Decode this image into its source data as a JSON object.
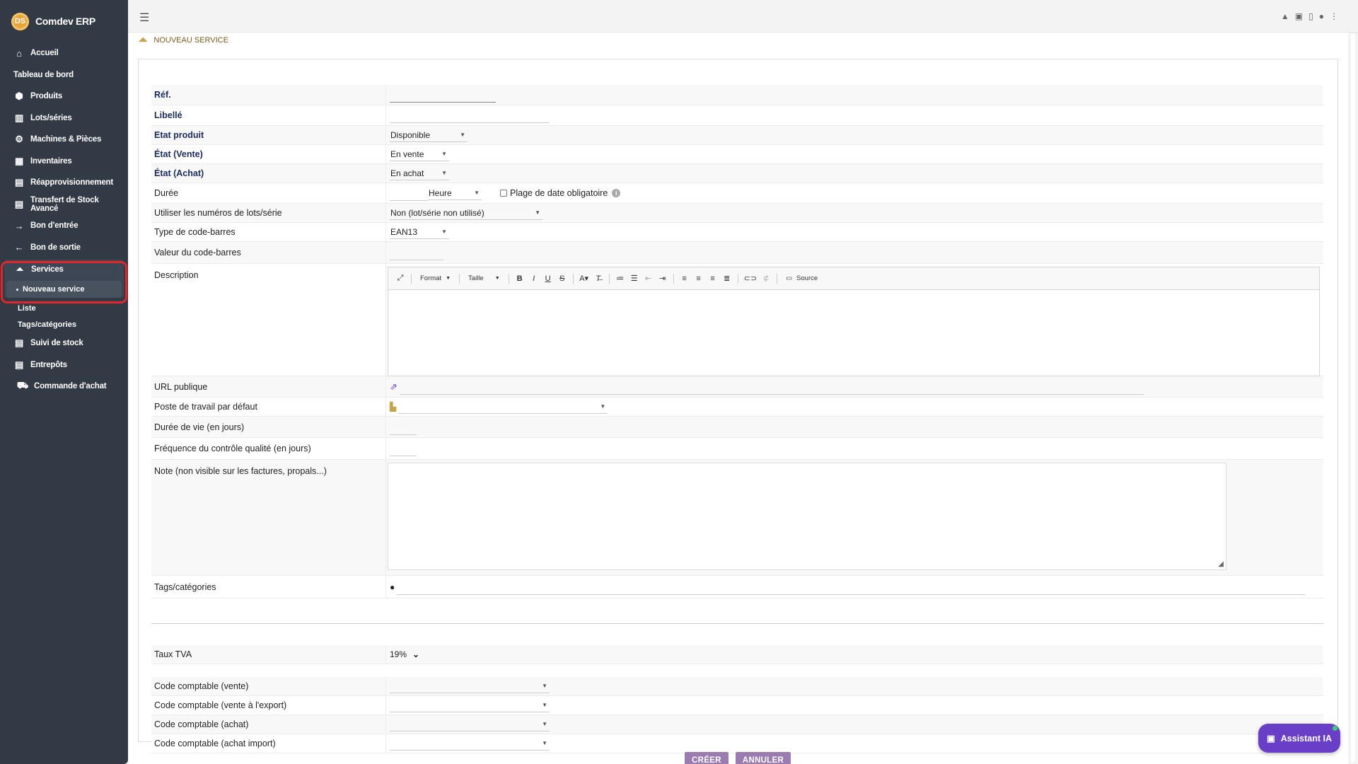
{
  "app": {
    "name": "Comdev ERP",
    "logo_text": "DS"
  },
  "sidebar": {
    "items": [
      {
        "label": "Accueil",
        "icon": "home-icon",
        "glyph": "⌂"
      },
      {
        "label": "Tableau de bord",
        "icon": "",
        "glyph": ""
      },
      {
        "label": "Produits",
        "icon": "cube-icon",
        "glyph": "⬢"
      },
      {
        "label": "Lots/séries",
        "icon": "barcode-icon",
        "glyph": "▥"
      },
      {
        "label": "Machines & Pièces",
        "icon": "cogs-icon",
        "glyph": "⚙"
      },
      {
        "label": "Inventaires",
        "icon": "boxes-icon",
        "glyph": "▦"
      },
      {
        "label": "Réapprovisionnement",
        "icon": "box-open-icon",
        "glyph": "▤"
      },
      {
        "label": "Transfert de Stock Avancé",
        "icon": "box-transfer-icon",
        "glyph": "▤"
      },
      {
        "label": "Bon d'entrée",
        "icon": "arrow-right-icon",
        "glyph": "→"
      },
      {
        "label": "Bon de sortie",
        "icon": "arrow-left-icon",
        "glyph": "←"
      }
    ],
    "services": {
      "label": "Services",
      "glyph": "⏶",
      "active_sub": "Nouveau service",
      "subs": [
        "Liste",
        "Tags/catégories"
      ]
    },
    "items_after": [
      {
        "label": "Suivi de stock",
        "icon": "box-open-icon",
        "glyph": "▤"
      },
      {
        "label": "Entrepôts",
        "icon": "warehouse-icon",
        "glyph": "▤"
      },
      {
        "label": "Commande d'achat",
        "icon": "dolly-icon",
        "glyph": "⛟"
      }
    ]
  },
  "topbar": {
    "menu_glyph": "☰",
    "icons": [
      "▲",
      "▣",
      "▯",
      "●",
      "⋮"
    ]
  },
  "page": {
    "title": "NOUVEAU SERVICE"
  },
  "form": {
    "ref_label": "Réf.",
    "ref_value": "",
    "libelle_label": "Libellé",
    "etat_produit_label": "Etat produit",
    "etat_produit_value": "Disponible",
    "etat_vente_label": "État (Vente)",
    "etat_vente_value": "En vente",
    "etat_achat_label": "État (Achat)",
    "etat_achat_value": "En achat",
    "duree_label": "Durée",
    "duree_unit": "Heure",
    "plage_label": "Plage de date obligatoire",
    "lots_label": "Utiliser les numéros de lots/série",
    "lots_value": "Non (lot/série non utilisé)",
    "barcode_type_label": "Type de code-barres",
    "barcode_type_value": "EAN13",
    "barcode_value_label": "Valeur du code-barres",
    "description_label": "Description",
    "editor": {
      "format": "Format",
      "size": "Taille",
      "source": "Source"
    },
    "url_label": "URL publique",
    "workstation_label": "Poste de travail par défaut",
    "lifetime_label": "Durée de vie (en jours)",
    "qc_label": "Fréquence du contrôle qualité (en jours)",
    "note_label": "Note (non visible sur les factures, propals...)",
    "tags_label": "Tags/catégories",
    "tva_label": "Taux TVA",
    "tva_value": "19%",
    "acc_vente_label": "Code comptable (vente)",
    "acc_vente_export_label": "Code comptable (vente à l'export)",
    "acc_achat_label": "Code comptable (achat)",
    "acc_achat_import_label": "Code comptable (achat import)"
  },
  "buttons": {
    "create": "CRÉER",
    "cancel": "ANNULER"
  },
  "assistant": {
    "label": "Assistant IA"
  },
  "colors": {
    "sidebar_bg": "#323a45",
    "accent": "#9b7cb0",
    "assistant": "#6a3fc7",
    "highlight": "#e0262b"
  }
}
